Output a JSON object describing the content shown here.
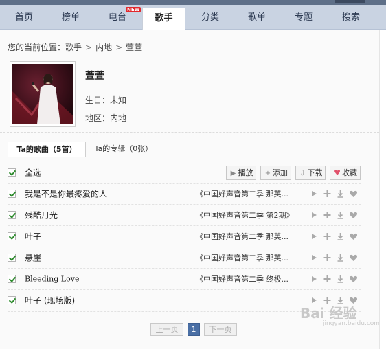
{
  "nav": {
    "items": [
      {
        "label": "首页"
      },
      {
        "label": "榜单"
      },
      {
        "label": "电台",
        "badge": "NEW"
      },
      {
        "label": "歌手",
        "active": true
      },
      {
        "label": "分类"
      },
      {
        "label": "歌单"
      },
      {
        "label": "专题"
      },
      {
        "label": "搜索"
      }
    ]
  },
  "breadcrumb": {
    "prefix": "您的当前位置：",
    "items": [
      "歌手",
      "内地",
      "萱萱"
    ]
  },
  "artist": {
    "name": "萱萱",
    "birthday": "生日：未知",
    "region": "地区：内地"
  },
  "tabs": {
    "songs": "Ta的歌曲（5首）",
    "albums": "Ta的专辑（0张）"
  },
  "toolbar": {
    "select_all": "全选",
    "play": "播放",
    "add": "添加",
    "download": "下载",
    "favorite": "收藏"
  },
  "songs": [
    {
      "title": "我是不是你最疼爱的人",
      "album": "《中国好声音第二季 那英..."
    },
    {
      "title": "残酷月光",
      "album": "《中国好声音第二季 第2期》"
    },
    {
      "title": "叶子",
      "album": "《中国好声音第二季 那英..."
    },
    {
      "title": "悬崖",
      "album": "《中国好声音第二季 那英..."
    },
    {
      "title": "Bleeding Love",
      "album": "《中国好声音第二季 终极..."
    },
    {
      "title": "叶子 (现场版)",
      "album": ""
    }
  ],
  "pager": {
    "prev": "上一页",
    "current": "1",
    "next": "下一页"
  },
  "watermark": {
    "brand": "Bai 经验",
    "sub": "jingyan.baidu.com"
  },
  "colors": {
    "nav_bg": "#c9d3e2",
    "check": "#2e8b2e",
    "heart": "#e0506a",
    "pager_active": "#4a6fa5"
  }
}
